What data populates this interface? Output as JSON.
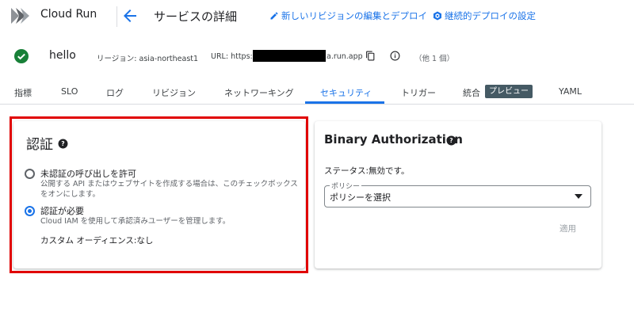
{
  "header": {
    "product": "Cloud Run",
    "page_title": "サービスの詳細",
    "actions": [
      {
        "label": "新しいリビジョンの編集とデプロイ",
        "icon": "pencil-icon"
      },
      {
        "label": "継続的デプロイの設定",
        "icon": "deploy-icon"
      }
    ]
  },
  "service": {
    "name": "hello",
    "region": "リージョン: asia-northeast1",
    "url_label": "URL: https://",
    "url_suffix": "a.run.app",
    "others": "（他 1 個）"
  },
  "tabs": [
    {
      "label": "指標"
    },
    {
      "label": "SLO"
    },
    {
      "label": "ログ"
    },
    {
      "label": "リビジョン"
    },
    {
      "label": "ネットワーキング"
    },
    {
      "label": "セキュリティ",
      "active": true
    },
    {
      "label": "トリガー"
    },
    {
      "label": "統合"
    },
    {
      "label": "YAML"
    }
  ],
  "preview_badge": "プレビュー",
  "auth": {
    "title": "認証",
    "options": [
      {
        "label": "未認証の呼び出しを許可",
        "description": "公開する API またはウェブサイトを作成する場合は、このチェックボックスをオンにします。",
        "selected": false
      },
      {
        "label": "認証が必要",
        "description": "Cloud IAM を使用して承認済みユーザーを管理します。",
        "selected": true
      }
    ],
    "audience": "カスタム オーディエンス:なし"
  },
  "binary": {
    "title": "Binary Authorization",
    "status": "ステータス:無効です。",
    "policy_label": "ポリシー",
    "policy_value": "ポリシーを選択",
    "apply_label": "適用"
  },
  "colors": {
    "accent": "#1a73e8",
    "success": "#188038",
    "highlight": "#e00000",
    "badge": "#455a64"
  }
}
